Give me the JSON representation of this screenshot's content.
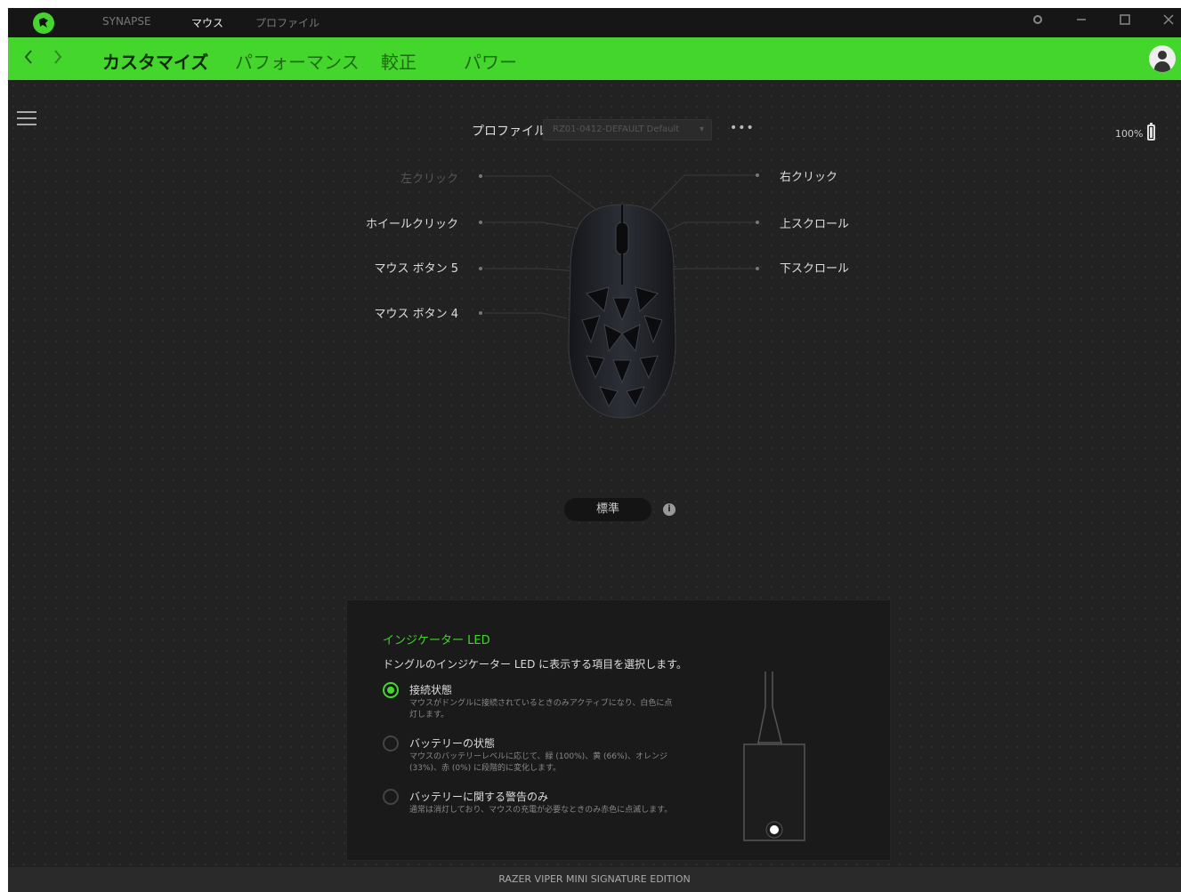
{
  "titlebar": {
    "tabs": [
      {
        "label": "SYNAPSE",
        "active": false
      },
      {
        "label": "マウス",
        "active": true
      },
      {
        "label": "プロファイル",
        "active": false
      }
    ]
  },
  "subnav": {
    "tabs": [
      {
        "label": "カスタマイズ",
        "active": true
      },
      {
        "label": "パフォーマンス",
        "active": false
      },
      {
        "label": "較正",
        "active": false
      },
      {
        "label": "パワー",
        "active": false
      }
    ]
  },
  "profile": {
    "label": "プロファイル",
    "selected": "RZ01-0412-DEFAULT Default",
    "more": "•••"
  },
  "battery": {
    "percent": "100%"
  },
  "buttons": {
    "left_click": "左クリック",
    "right_click": "右クリック",
    "wheel_click": "ホイールクリック",
    "scroll_up": "上スクロール",
    "mouse_button_5": "マウス ボタン 5",
    "scroll_down": "下スクロール",
    "mouse_button_4": "マウス ボタン 4"
  },
  "mode_button": {
    "label": "標準",
    "info": "i"
  },
  "indicator_led": {
    "title": "インジケーター LED",
    "description": "ドングルのインジケーター LED に表示する項目を選択します。",
    "options": [
      {
        "title": "接続状態",
        "desc": "マウスがドングルに接続されているときのみアクティブになり、白色に点灯します。",
        "selected": true
      },
      {
        "title": "バッテリーの状態",
        "desc": "マウスのバッテリーレベルに応じて、緑 (100%)、黄 (66%)、オレンジ (33%)、赤 (0%) に段階的に変化します。",
        "selected": false
      },
      {
        "title": "バッテリーに関する警告のみ",
        "desc": "通常は消灯しており、マウスの充電が必要なときのみ赤色に点滅します。",
        "selected": false
      }
    ]
  },
  "footer": {
    "device": "RAZER VIPER MINI SIGNATURE EDITION"
  },
  "colors": {
    "accent": "#44d62c",
    "background": "#222222"
  }
}
